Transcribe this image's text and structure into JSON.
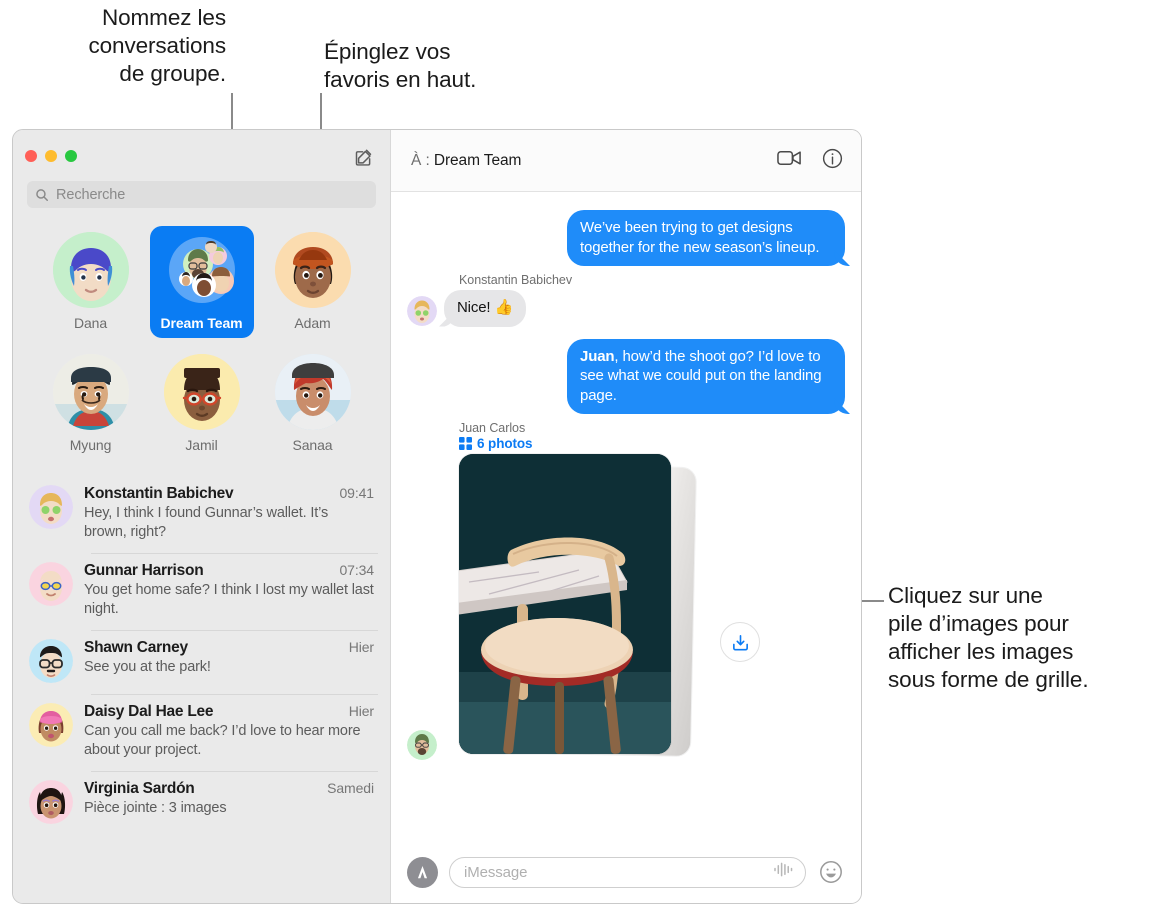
{
  "callouts": {
    "group": "Nommez les\nconversations\nde groupe.",
    "pin": "Épinglez vos\nfavoris en haut.",
    "stack": "Cliquez sur une\npile d’images pour\nafficher les images\nsous forme de grille."
  },
  "window": {
    "traffic_lights": [
      "close",
      "minimize",
      "maximize"
    ],
    "colors": {
      "close": "#FF5F57",
      "minimize": "#FEBC2E",
      "maximize": "#28C840",
      "accent_blue": "#0A7CF3",
      "bubble_blue": "#1F8CF9",
      "bubble_gray": "#E6E6E8",
      "sidebar_bg": "#EAEAEA"
    }
  },
  "sidebar": {
    "compose_icon": "compose-icon",
    "search": {
      "placeholder": "Recherche",
      "value": "",
      "icon": "search-icon"
    },
    "pinned": [
      {
        "name": "Dana",
        "selected": false,
        "avatar_bg": "#C5EFCB"
      },
      {
        "name": "Dream Team",
        "selected": true,
        "avatar_bg": "#63A9F6"
      },
      {
        "name": "Adam",
        "selected": false,
        "avatar_bg": "#FBDCAF"
      },
      {
        "name": "Myung",
        "selected": false,
        "avatar_bg": "#EFEFEA"
      },
      {
        "name": "Jamil",
        "selected": false,
        "avatar_bg": "#FBEBAE"
      },
      {
        "name": "Sanaa",
        "selected": false,
        "avatar_bg": "#DCEAF6"
      }
    ],
    "conversations": [
      {
        "name": "Konstantin Babichev",
        "time": "09:41",
        "preview": "Hey, I think I found Gunnar’s wallet. It’s brown, right?",
        "avatar_bg": "#E3D9F5"
      },
      {
        "name": "Gunnar Harrison",
        "time": "07:34",
        "preview": "You get home safe? I think I lost my wallet last night.",
        "avatar_bg": "#FAD4E0"
      },
      {
        "name": "Shawn Carney",
        "time": "Hier",
        "preview": "See you at the park!",
        "avatar_bg": "#BFE7F7"
      },
      {
        "name": "Daisy Dal Hae Lee",
        "time": "Hier",
        "preview": "Can you call me back? I’d love to hear more about your project.",
        "avatar_bg": "#FBECB4"
      },
      {
        "name": "Virginia Sardón",
        "time": "Samedi",
        "preview": "Pièce jointe : 3 images",
        "avatar_bg": "#FAD4E0"
      }
    ]
  },
  "chat": {
    "to_prefix": "À :",
    "to_name": "Dream Team",
    "facetime_icon": "video-camera-icon",
    "info_icon": "info-circle-icon",
    "messages": [
      {
        "direction": "out",
        "text": "We’ve been trying to get designs together for the new season’s lineup."
      },
      {
        "direction": "in",
        "sender": "Konstantin Babichev",
        "text": "Nice!  👍",
        "avatar_bg": "#E3D9F5"
      },
      {
        "direction": "out",
        "text_bold": "Juan",
        "text": ", how’d the shoot go? I’d love to see what we could put on the landing page."
      }
    ],
    "attachment": {
      "sender": "Juan Carlos",
      "photos_label": "6 photos",
      "photos_count": 6,
      "grid_icon": "grid-icon",
      "download_icon": "download-icon",
      "avatar_bg": "#C5EFCB"
    },
    "compose": {
      "appstore_icon": "appstore-icon",
      "placeholder": "iMessage",
      "value": "",
      "audio_icon": "audio-waveform-icon",
      "emoji_icon": "emoji-smiley-icon"
    }
  }
}
